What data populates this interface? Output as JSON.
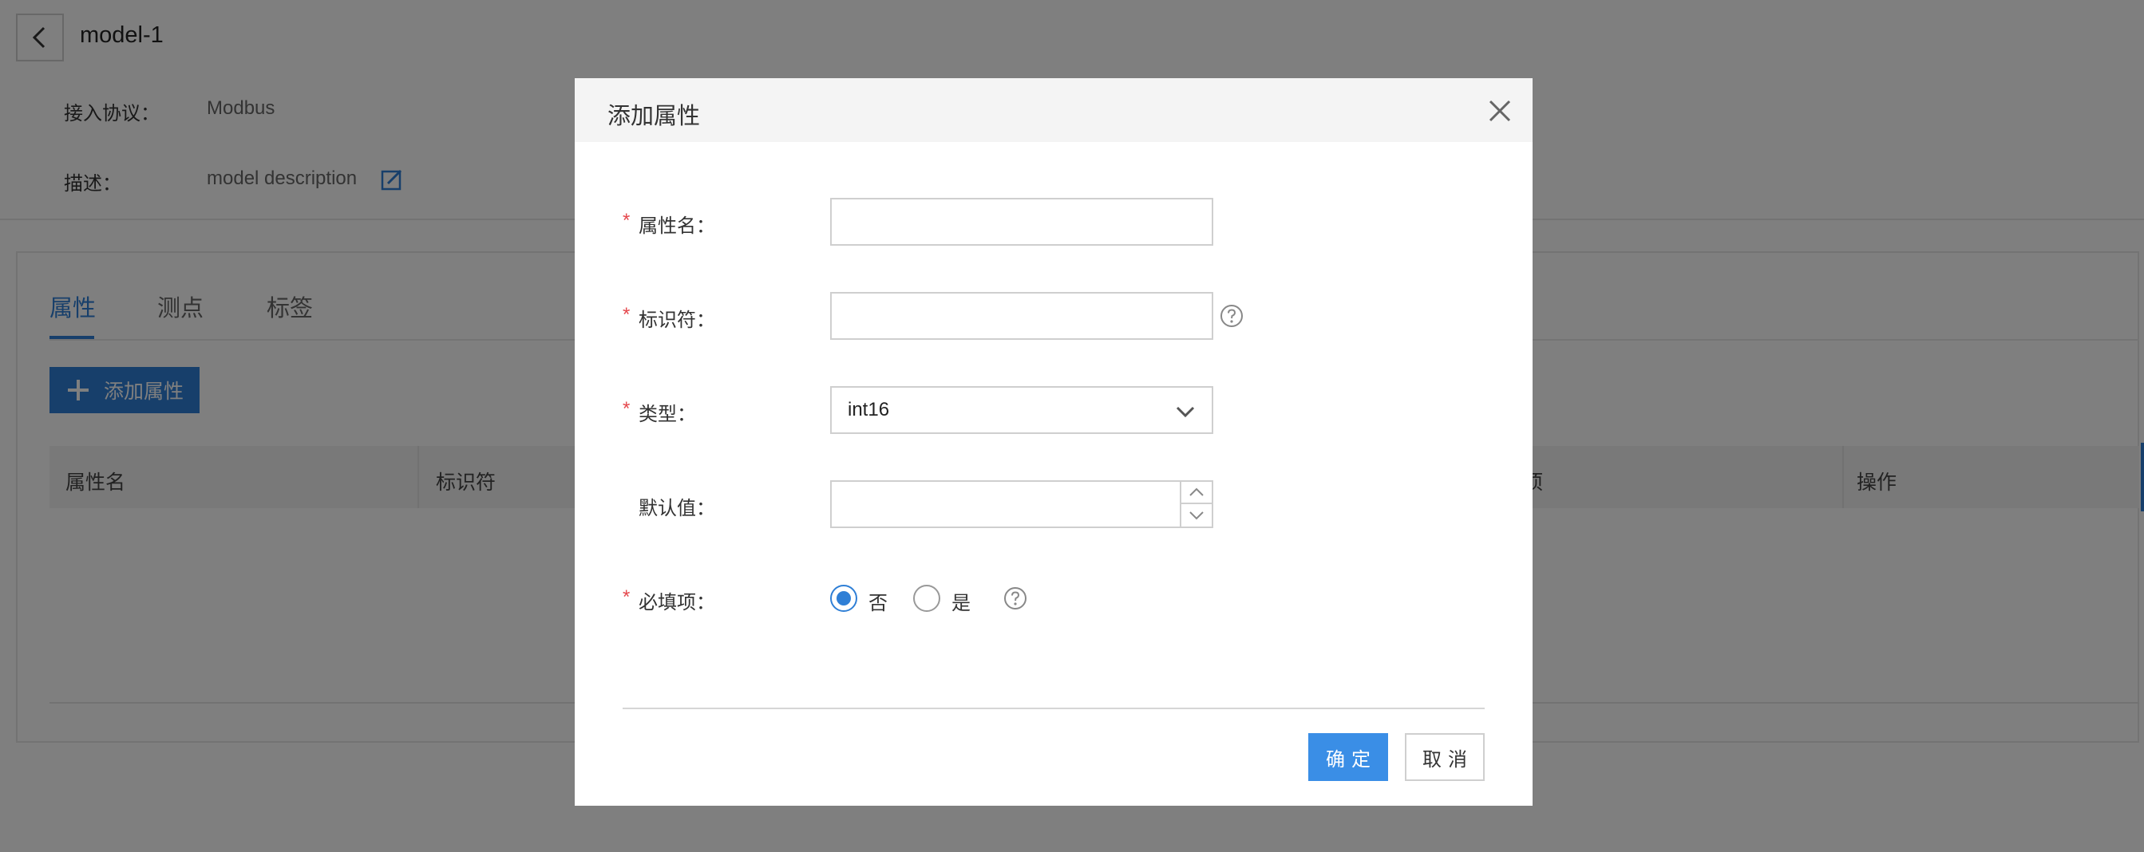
{
  "header": {
    "title": "model-1",
    "protocol_label": "接入协议：",
    "protocol_value": "Modbus",
    "description_label": "描述：",
    "description_value": "model description"
  },
  "tabs": [
    {
      "label": "属性",
      "active": true
    },
    {
      "label": "测点",
      "active": false
    },
    {
      "label": "标签",
      "active": false
    }
  ],
  "toolbar": {
    "add_label": "添加属性"
  },
  "table": {
    "columns": [
      "属性名",
      "标识符",
      "项",
      "操作"
    ]
  },
  "modal": {
    "title": "添加属性",
    "fields": {
      "name": {
        "label": "属性名：",
        "required": true,
        "value": ""
      },
      "identifier": {
        "label": "标识符：",
        "required": true,
        "value": ""
      },
      "type": {
        "label": "类型：",
        "required": true,
        "value": "int16"
      },
      "default": {
        "label": "默认值：",
        "required": false,
        "value": ""
      },
      "required_field": {
        "label": "必填项：",
        "required": true,
        "options": [
          {
            "label": "否",
            "checked": true
          },
          {
            "label": "是",
            "checked": false
          }
        ]
      }
    },
    "required_mark": "*",
    "ok_label": "确定",
    "cancel_label": "取消"
  },
  "colors": {
    "accent": "#2f7fd6",
    "primary_button": "#3a8ee6",
    "required_mark": "#e5484d",
    "overlay": "rgba(0,0,0,0.5)"
  },
  "icons": [
    "back-arrow-icon",
    "edit-icon",
    "plus-icon",
    "close-icon",
    "help-icon",
    "chevron-down-icon",
    "chevron-up-icon"
  ]
}
